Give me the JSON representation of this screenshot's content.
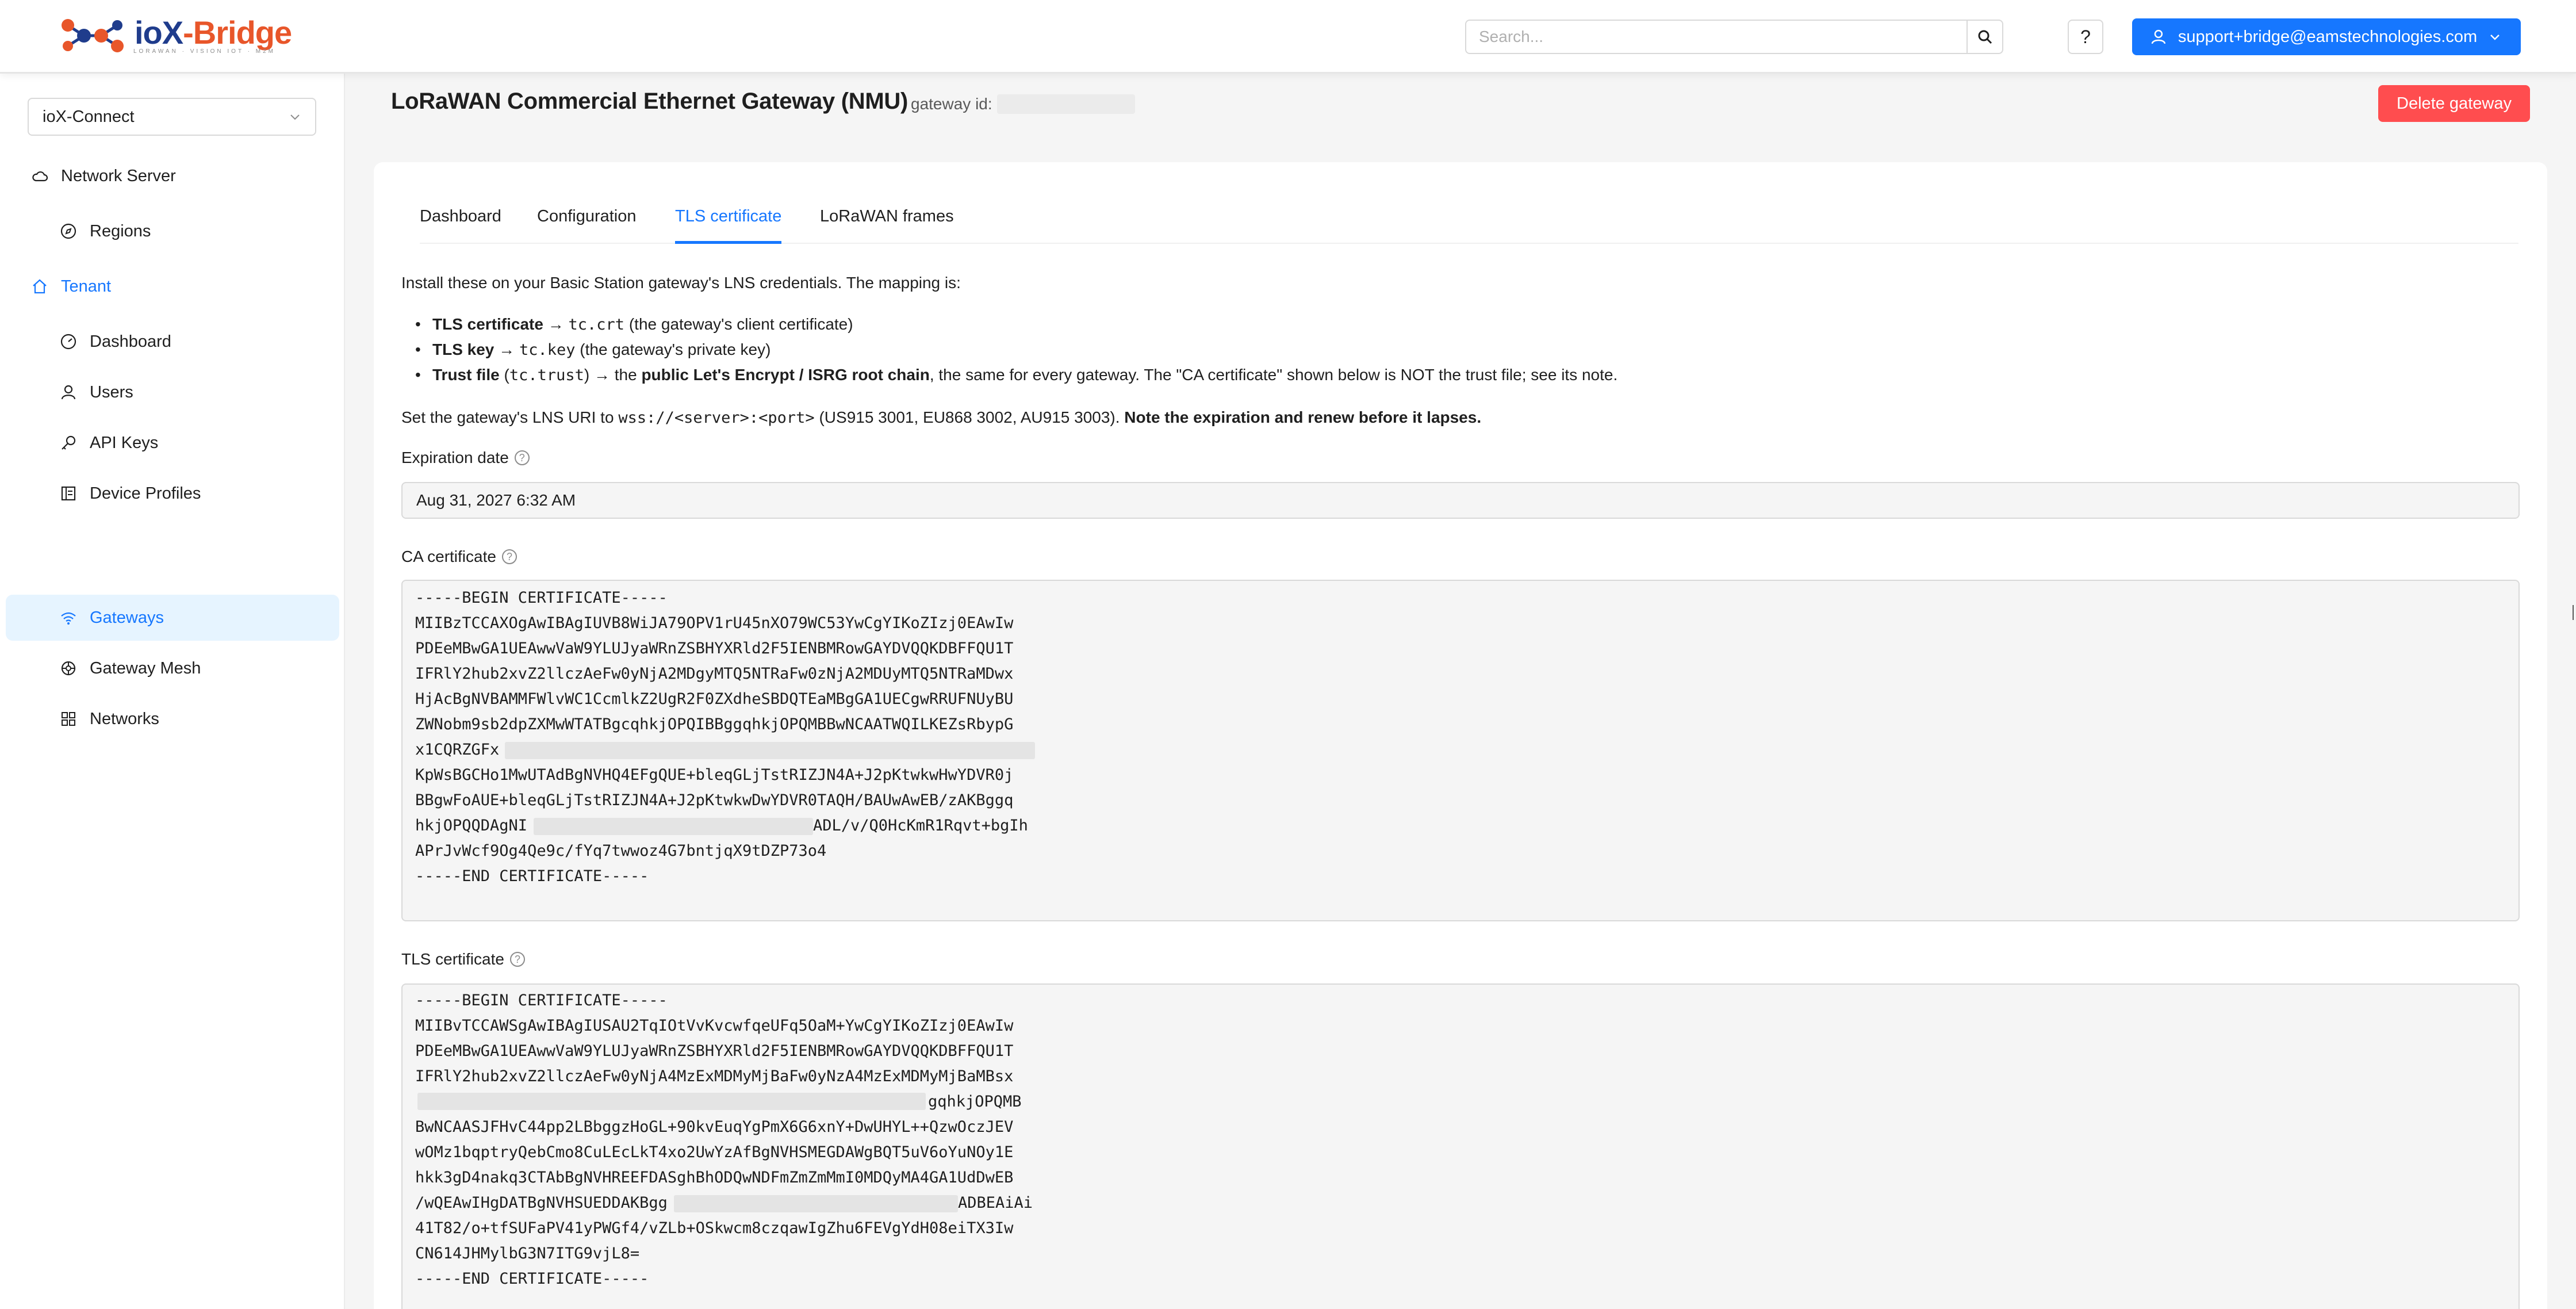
{
  "app": {
    "logo_main": "ioX",
    "logo_dash": "-",
    "logo_b": "Bridge",
    "logo_tagline": "LORAWAN · VISION IOT · M2M"
  },
  "header": {
    "search_placeholder": "Search...",
    "help_label": "?",
    "user_email": "support+bridge@eamstechnologies.com"
  },
  "sidebar": {
    "tenant_selected": "ioX-Connect",
    "network_server": "Network Server",
    "regions": "Regions",
    "tenant": "Tenant",
    "items": [
      "Dashboard",
      "Users",
      "API Keys",
      "Device Profiles",
      "Gateways",
      "Gateway Mesh",
      "Networks"
    ]
  },
  "page": {
    "title": "LoRaWAN Commercial Ethernet Gateway (NMU)",
    "gateway_id_label": "gateway id:",
    "delete_label": "Delete gateway"
  },
  "tabs": [
    "Dashboard",
    "Configuration",
    "TLS certificate",
    "LoRaWAN frames"
  ],
  "intro": {
    "line1": "Install these on your Basic Station gateway's LNS credentials. The mapping is:",
    "b1_bold": "TLS certificate",
    "b1_arrow": " → ",
    "b1_code": "tc.crt",
    "b1_rest": " (the gateway's client certificate)",
    "b2_bold": "TLS key",
    "b2_arrow": " → ",
    "b2_code": "tc.key",
    "b2_rest": " (the gateway's private key)",
    "b3_bold": "Trust file",
    "b3_pre": " (",
    "b3_code": "tc.trust",
    "b3_mid": ") → the ",
    "b3_bold2": "public Let's Encrypt / ISRG root chain",
    "b3_rest": ", the same for every gateway. The \"CA certificate\" shown below is NOT the trust file; see its note.",
    "uri_pre": "Set the gateway's LNS URI to ",
    "uri_code": "wss://<server>:<port>",
    "uri_rest": " (US915 3001, EU868 3002, AU915 3003). ",
    "uri_bold": "Note the expiration and renew before it lapses."
  },
  "expiration": {
    "label": "Expiration date",
    "value": "Aug 31, 2027 6:32 AM"
  },
  "ca_cert": {
    "label": "CA certificate",
    "lines": [
      "-----BEGIN CERTIFICATE-----",
      "MIIBzTCCAXOgAwIBAgIUVB8WiJA79OPV1rU45nXO79WC53YwCgYIKoZIzj0EAwIw",
      "PDEeMBwGA1UEAwwVaW9YLUJyaWRnZSBHYXRld2F5IENBMRowGAYDVQQKDBFFQU1T",
      "IFRlY2hub2xvZ2llczAeFw0yNjA2MDgyMTQ5NTRaFw0zNjA2MDUyMTQ5NTRaMDwx",
      "HjAcBgNVBAMMFWlvWC1CcmlkZ2UgR2F0ZXdheSBDQTEaMBgGA1UECgwRRUFNUyBU",
      "ZWNobm9sb2dpZXMwWTATBgcqhkjOPQIBBggqhkjOPQMBBwNCAATWQILKEZsRbypG",
      "x1CQRZGFx",
      "KpWsBGCHo1MwUTAdBgNVHQ4EFgQUE+bleqGLjTstRIZJN4A+J2pKtwkwHwYDVR0j",
      "BBgwFoAUE+bleqGLjTstRIZJN4A+J2pKtwkwDwYDVR0TAQH/BAUwAwEB/zAKBggq",
      "hkjOPQQDAgNI",
      "APrJvWcf9Og4Qe9c/fYq7twwoz4G7bntjqX9tDZP73o4",
      "-----END CERTIFICATE-----"
    ],
    "line9_tail": "ADL/v/Q0HcKmR1Rqvt+bgIh"
  },
  "tls_cert": {
    "label": "TLS certificate",
    "lines": [
      "-----BEGIN CERTIFICATE-----",
      "MIIBvTCCAWSgAwIBAgIUSAU2TqIOtVvKvcwfqeUFq5OaM+YwCgYIKoZIzj0EAwIw",
      "PDEeMBwGA1UEAwwVaW9YLUJyaWRnZSBHYXRld2F5IENBMRowGAYDVQQKDBFFQU1T",
      "IFRlY2hub2xvZ2llczAeFw0yNjA4MzExMDMyMjBaFw0yNzA4MzExMDMyMjBaMBsx",
      "",
      "BwNCAASJFHvC44pp2LBbggzHoGL+90kvEuqYgPmX6G6xnY+DwUHYL++QzwOczJEV",
      "wOMz1bqptryQebCmo8CuLEcLkT4xo2UwYzAfBgNVHSMEGDAWgBQT5uV6oYuNOy1E",
      "hkk3gD4nakq3CTAbBgNVHREEFDASghBhODQwNDFmZmZmMmI0MDQyMA4GA1UdDwEB",
      "/wQEAwIHgDATBgNVHSUEDDAKBgg",
      "41T82/o+tfSUFaPV41yPWGf4/vZLb+OSkwcm8czqawIgZhu6FEVgYdH08eiTX3Iw",
      "CN614JHMylbG3N7ITG9vjL8=",
      "-----END CERTIFICATE-----"
    ],
    "line4_tail": "gqhkjOPQMB",
    "line8_tail": "ADBEAiAi"
  }
}
